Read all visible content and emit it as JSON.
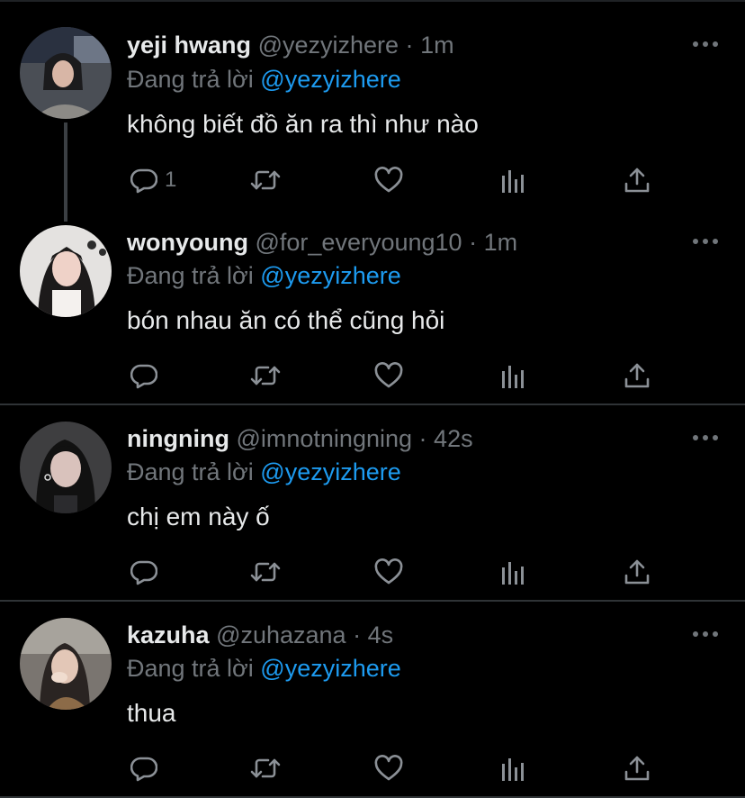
{
  "reply_prefix": "Đang trả lời",
  "colors": {
    "background": "#000000",
    "text": "#e7e9ea",
    "muted": "#71767b",
    "link": "#1d9bf0",
    "divider": "#2f3336"
  },
  "tweets": [
    {
      "name": "yeji hwang",
      "handle": "@yezyizhere",
      "separator": "·",
      "time": "1m",
      "reply_to": "@yezyizhere",
      "text": "không biết đồ ăn ra thì như nào",
      "reply_count": "1"
    },
    {
      "name": "wonyoung",
      "handle": "@for_everyoung10",
      "separator": "·",
      "time": "1m",
      "reply_to": "@yezyizhere",
      "text": "bón nhau ăn có thể cũng hỏi",
      "reply_count": ""
    },
    {
      "name": "ningning",
      "handle": "@imnotningning",
      "separator": "·",
      "time": "42s",
      "reply_to": "@yezyizhere",
      "text": "chị em này ố",
      "reply_count": ""
    },
    {
      "name": "kazuha",
      "handle": "@zuhazana",
      "separator": "·",
      "time": "4s",
      "reply_to": "@yezyizhere",
      "text": "thua",
      "reply_count": ""
    }
  ],
  "icons": [
    "more-icon",
    "reply-icon",
    "retweet-icon",
    "like-icon",
    "analytics-icon",
    "share-icon"
  ]
}
